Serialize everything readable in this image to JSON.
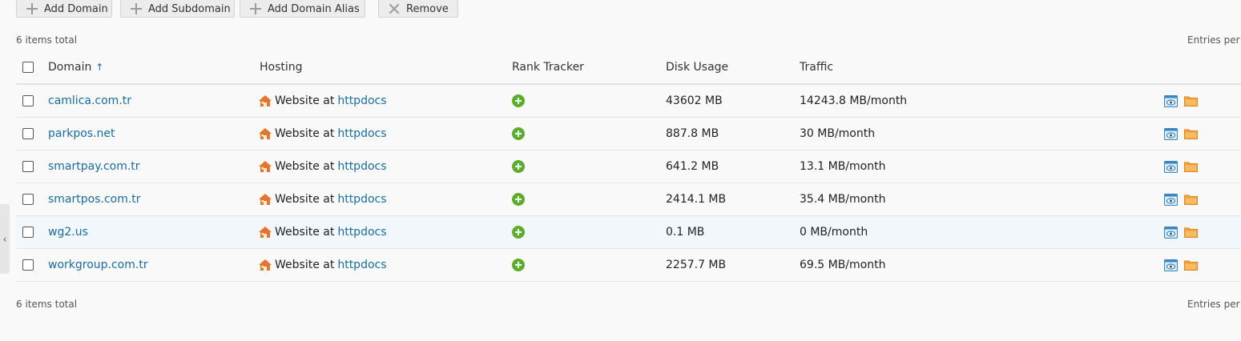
{
  "toolbar": {
    "add_domain": "Add Domain",
    "add_subdomain": "Add Subdomain",
    "add_domain_alias": "Add Domain Alias",
    "remove": "Remove"
  },
  "summary": {
    "items_total_top": "6 items total",
    "items_total_bottom": "6 items total",
    "entries_per_page_top": "Entries per p",
    "entries_per_page_bottom": "Entries per p"
  },
  "columns": {
    "domain": "Domain",
    "sort_indicator": "↑",
    "hosting": "Hosting",
    "rank_tracker": "Rank Tracker",
    "disk_usage": "Disk Usage",
    "traffic": "Traffic"
  },
  "rows": [
    {
      "domain": "camlica.com.tr",
      "hosting_prefix": "Website at",
      "hosting_link": "httpdocs",
      "disk": "43602 MB",
      "traffic": "14243.8 MB/month"
    },
    {
      "domain": "parkpos.net",
      "hosting_prefix": "Website at",
      "hosting_link": "httpdocs",
      "disk": "887.8 MB",
      "traffic": "30 MB/month"
    },
    {
      "domain": "smartpay.com.tr",
      "hosting_prefix": "Website at",
      "hosting_link": "httpdocs",
      "disk": "641.2 MB",
      "traffic": "13.1 MB/month"
    },
    {
      "domain": "smartpos.com.tr",
      "hosting_prefix": "Website at",
      "hosting_link": "httpdocs",
      "disk": "2414.1 MB",
      "traffic": "35.4 MB/month"
    },
    {
      "domain": "wg2.us",
      "hosting_prefix": "Website at",
      "hosting_link": "httpdocs",
      "disk": "0.1 MB",
      "traffic": "0 MB/month"
    },
    {
      "domain": "workgroup.com.tr",
      "hosting_prefix": "Website at",
      "hosting_link": "httpdocs",
      "disk": "2257.7 MB",
      "traffic": "69.5 MB/month"
    }
  ],
  "side_tab_glyph": "‹",
  "colors": {
    "link": "#1b6c9e",
    "add_green": "#5aae2c",
    "folder_orange": "#f0a23c",
    "house_orange": "#e8742a",
    "row_highlight": "#f1f7fb"
  },
  "icons": {
    "toolbar_add": "plus-icon",
    "toolbar_remove": "close-icon",
    "hosting": "house-icon",
    "rank_tracker": "add-circle-icon",
    "row_preview": "preview-icon",
    "row_files": "folder-icon"
  }
}
